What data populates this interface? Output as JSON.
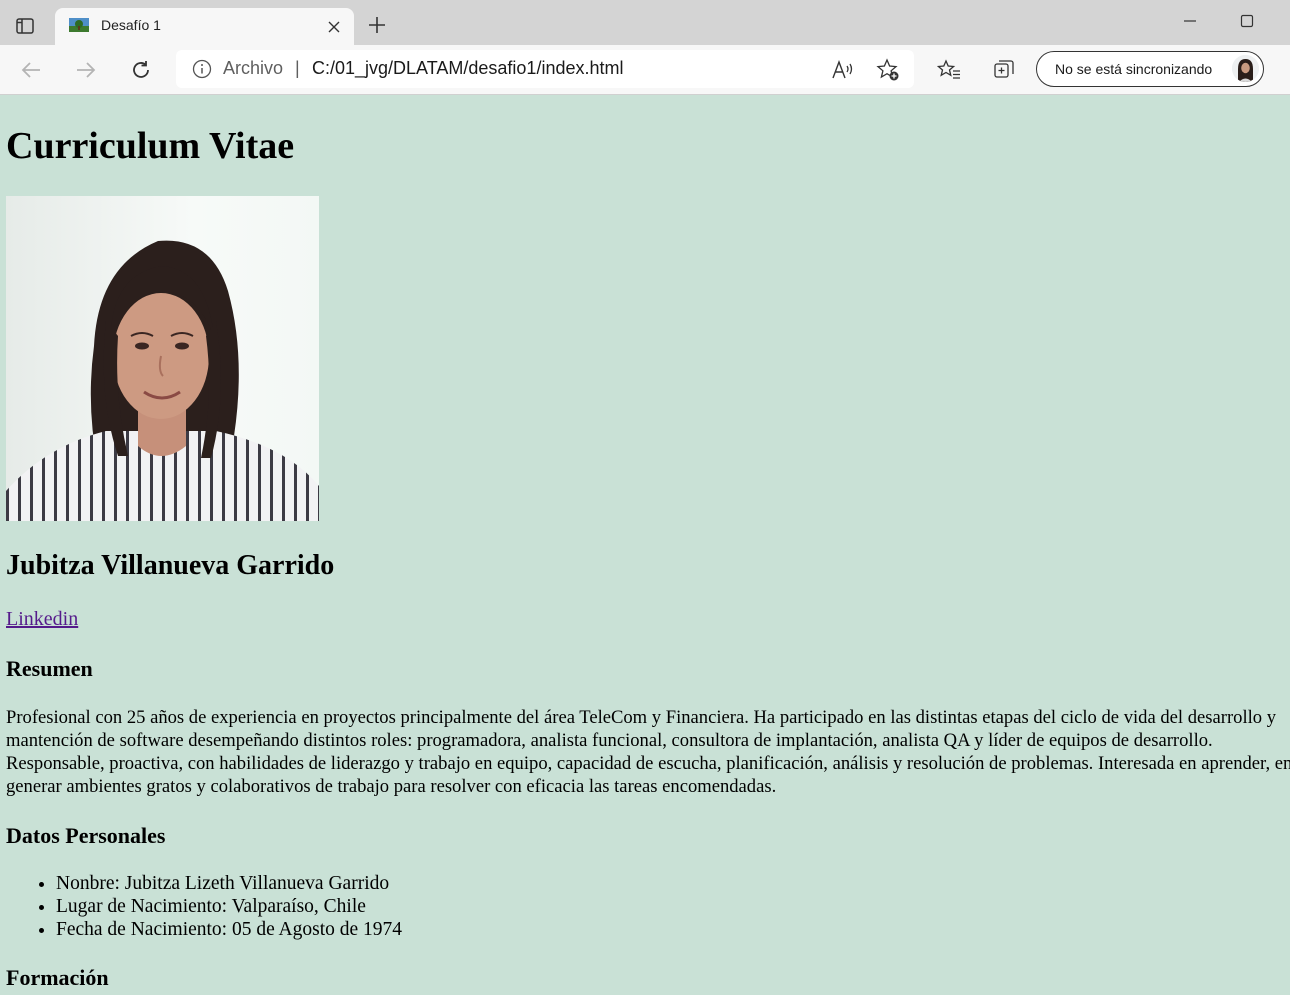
{
  "browser": {
    "tab_title": "Desafío 1",
    "address_scheme": "Archivo",
    "address_separator": "|",
    "address_url": "C:/01_jvg/DLATAM/desafio1/index.html",
    "sync_label": "No se está sincronizando",
    "icons": [
      "tab-actions-icon",
      "favicon-icon",
      "close-icon",
      "plus-icon",
      "minimize-icon",
      "maximize-icon",
      "back-icon",
      "forward-icon",
      "refresh-icon",
      "info-icon",
      "read-aloud-icon",
      "add-favorite-icon",
      "favorites-icon",
      "collections-icon"
    ]
  },
  "page": {
    "title": "Curriculum Vitae",
    "name": "Jubitza Villanueva Garrido",
    "link_label": "Linkedin",
    "resumen_heading": "Resumen",
    "resumen_text": "Profesional con 25 años de experiencia en proyectos principalmente del área TeleCom y Financiera. Ha participado en las distintas etapas del ciclo de vida del desarrollo y mantención de software desempeñando distintos roles: programadora, analista funcional, consultora de implantación, analista QA y líder de equipos de desarrollo. Responsable, proactiva, con habilidades de liderazgo y trabajo en equipo, capacidad de escucha, planificación, análisis y resolución de problemas. Interesada en aprender, en generar ambientes gratos y colaborativos de trabajo para resolver con eficacia las tareas encomendadas.",
    "datos_heading": "Datos Personales",
    "datos": [
      "Nonbre: Jubitza Lizeth Villanueva Garrido",
      "Lugar de Nacimiento: Valparaíso, Chile",
      "Fecha de Nacimiento: 05 de Agosto de 1974"
    ],
    "formacion_heading": "Formación"
  },
  "colors": {
    "page_background": "#c9e1d6",
    "link_visited": "#551a8b",
    "tabbar": "#d4d4d4",
    "toolbar": "#f7f7f7"
  }
}
